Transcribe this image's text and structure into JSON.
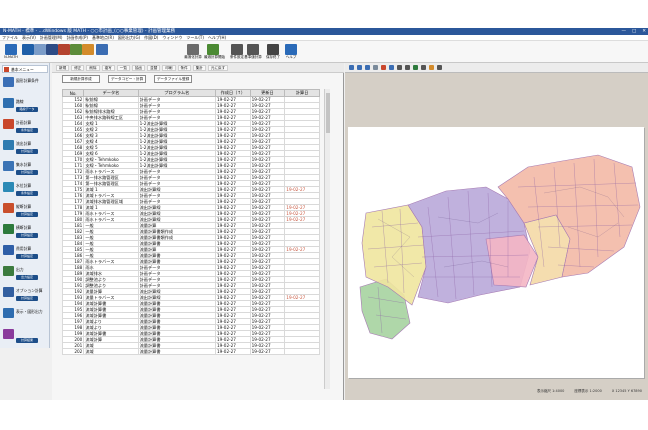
{
  "title_bar": {
    "title": "N-MATH - 標準 - ...dWindows 版 MATH - ○○市計画_(○○事業管理) - 計画管理業務",
    "sys_minimize": "—",
    "sys_maximize": "□",
    "sys_close": "✕"
  },
  "menu": [
    "ファイル",
    "表示(V)",
    "計画管理(M)",
    "計画作成(P)",
    "基準地点(R)",
    "図形出力(G)",
    "作図(D)",
    "ウィンドウ",
    "ツール(T)",
    "ヘルプ(H)"
  ],
  "toolbar": {
    "buttons": [
      {
        "label": "N-MATH",
        "icon": "app-icon",
        "color": "#2a6ab8"
      },
      {
        "label": "",
        "icon": "mountain-icon",
        "color": "#1f5fa8"
      },
      {
        "label": "",
        "icon": "table-icon",
        "color": "#7b9cc8"
      },
      {
        "label": "",
        "icon": "flag-icon",
        "color": "#2d4c86"
      },
      {
        "label": "",
        "icon": "truck-icon",
        "color": "#b4432f"
      },
      {
        "label": "",
        "icon": "blocks-icon",
        "color": "#5c8c3a"
      },
      {
        "label": "",
        "icon": "stamp-icon",
        "color": "#d38b2b"
      },
      {
        "label": "",
        "icon": "map-icon",
        "color": "#3b6db3"
      },
      {
        "label": "最適化計算",
        "icon": "grid-calc-icon",
        "color": "#6b6b6b"
      },
      {
        "label": "最適計算開始",
        "icon": "calc-start-icon",
        "color": "#4b8a33"
      },
      {
        "label": "条件設定",
        "icon": "condition-icon",
        "color": "#555555"
      },
      {
        "label": "基準値計算",
        "icon": "base-calc-icon",
        "color": "#555555"
      },
      {
        "label": "保存終了",
        "icon": "save-icon",
        "color": "#444444"
      },
      {
        "label": "ヘルプ",
        "icon": "help-icon",
        "color": "#2a6ab8"
      }
    ]
  },
  "sidebar": {
    "header": "基本メニュー",
    "items": [
      {
        "label": "図形計算条件",
        "chip": "",
        "icon": "shape-icon",
        "color": "#3b6fb6"
      },
      {
        "label": "路線",
        "chip": "路線データ",
        "icon": "route-icon",
        "color": "#2f6fb0"
      },
      {
        "label": "計画計算",
        "chip": "条件設定",
        "icon": "plan-icon",
        "color": "#c9472c"
      },
      {
        "label": "流出計算",
        "chip": "計算設定",
        "icon": "flow-icon",
        "color": "#2e7bb0"
      },
      {
        "label": "集水計算",
        "chip": "計算設定",
        "icon": "catchment-icon",
        "color": "#3b73b5"
      },
      {
        "label": "水位計算",
        "chip": "条件設定",
        "icon": "water-icon",
        "color": "#2c8ab6"
      },
      {
        "label": "縦断計算",
        "chip": "計算設定",
        "icon": "profile-icon",
        "color": "#c94f2c"
      },
      {
        "label": "横断計算",
        "chip": "計算設定",
        "icon": "cross-icon",
        "color": "#2d7a3c"
      },
      {
        "label": "費用計算",
        "chip": "計算設定",
        "icon": "cost-icon",
        "color": "#2f5fa8"
      },
      {
        "label": "出力",
        "chip": "出力設定",
        "icon": "output-icon",
        "color": "#3c7b3e"
      },
      {
        "label": "オプション計算",
        "chip": "計算設定",
        "icon": "option-icon",
        "color": "#335fa0"
      },
      {
        "label": "表示・図形出力",
        "chip": "",
        "icon": "display-icon",
        "color": "#2f6db0"
      },
      {
        "label": "",
        "chip": "計算結果",
        "icon": "result-icon",
        "color": "#8a3b9c"
      }
    ]
  },
  "grid_panel": {
    "tabs": [
      "新規",
      "修正",
      "削除",
      "複写",
      "一覧",
      "抽出",
      "並替",
      "印刷",
      "条件",
      "集計",
      "元に戻す"
    ],
    "buttons": [
      "新規計算作成",
      "データコピー・計算",
      "データファイル登録"
    ],
    "columns": [
      "No.",
      "データ名",
      "プログラム名",
      "作成日（↑）",
      "更新日",
      "計算日"
    ],
    "rows": [
      [
        "152",
        "駅前線",
        "計画データ",
        "19-02-27",
        "19-02-27",
        ""
      ],
      [
        "160",
        "駅前線",
        "計画データ",
        "19-02-27",
        "19-02-27",
        ""
      ],
      [
        "162",
        "駅前線排水路線",
        "計画データ",
        "19-02-27",
        "19-02-27",
        ""
      ],
      [
        "163",
        "中央排水路幹線工区",
        "計画データ",
        "19-02-27",
        "19-02-27",
        ""
      ],
      [
        "164",
        "支線 1",
        "1-2流出計算線",
        "19-02-27",
        "19-02-27",
        ""
      ],
      [
        "165",
        "支線 2",
        "1-2流出計算線",
        "19-02-27",
        "19-02-27",
        ""
      ],
      [
        "166",
        "支線 3",
        "1-2流出計算線",
        "19-02-27",
        "19-02-27",
        ""
      ],
      [
        "167",
        "支線 4",
        "1-2流出計算線",
        "19-02-27",
        "19-02-27",
        ""
      ],
      [
        "168",
        "支線 5",
        "1-2流出計算線",
        "19-02-27",
        "19-02-27",
        ""
      ],
      [
        "169",
        "支線 6",
        "1-2流出計算線",
        "19-02-27",
        "19-02-27",
        ""
      ],
      [
        "170",
        "支線・Tehmkoko",
        "1-2流出計算線",
        "19-02-27",
        "19-02-27",
        ""
      ],
      [
        "171",
        "支線・Tehmkoko",
        "1-2流出計算線",
        "19-02-27",
        "19-02-27",
        ""
      ],
      [
        "172",
        "雨水トラバース",
        "計画データ",
        "19-02-27",
        "19-02-27",
        ""
      ],
      [
        "173",
        "第一排水路管理区",
        "計画データ",
        "19-02-27",
        "19-02-27",
        ""
      ],
      [
        "174",
        "第一排水路管理区",
        "計画データ",
        "19-02-27",
        "19-02-27",
        ""
      ],
      [
        "175",
        "流域 1",
        "流出計算線",
        "19-02-27",
        "19-02-27",
        "19-02-27"
      ],
      [
        "176",
        "流域トラバース",
        "計画データ",
        "19-02-27",
        "19-02-27",
        ""
      ],
      [
        "177",
        "流域排水路管理区域",
        "計画データ",
        "19-02-27",
        "19-02-27",
        ""
      ],
      [
        "178",
        "流域 1",
        "流出計算線",
        "19-02-27",
        "19-02-27",
        "19-02-27"
      ],
      [
        "179",
        "雨水トラバース",
        "流出計算線",
        "19-02-27",
        "19-02-27",
        "19-02-27"
      ],
      [
        "180",
        "雨水トラバース",
        "流出計算線",
        "19-02-27",
        "19-02-27",
        "19-02-27"
      ],
      [
        "181",
        "一般",
        "流量計算",
        "19-02-27",
        "19-02-27",
        ""
      ],
      [
        "182",
        "一般",
        "流量計算書類作成",
        "19-02-27",
        "19-02-27",
        ""
      ],
      [
        "183",
        "一般",
        "流量計算書類作成",
        "19-02-27",
        "19-02-27",
        ""
      ],
      [
        "184",
        "一般",
        "流量計算書",
        "19-02-27",
        "19-02-27",
        ""
      ],
      [
        "185",
        "一般",
        "流量計算",
        "19-02-27",
        "19-02-27",
        "19-02-27"
      ],
      [
        "186",
        "一般",
        "流量計算書",
        "19-02-27",
        "19-02-27",
        ""
      ],
      [
        "187",
        "雨水トラバース",
        "流量計算書",
        "19-02-27",
        "19-02-27",
        ""
      ],
      [
        "188",
        "雨水",
        "計画データ",
        "19-02-27",
        "19-02-27",
        ""
      ],
      [
        "189",
        "流域排水",
        "計画データ",
        "19-02-27",
        "19-02-27",
        ""
      ],
      [
        "190",
        "調整池より",
        "計画データ",
        "19-02-27",
        "19-02-27",
        ""
      ],
      [
        "191",
        "調整池より",
        "計画データ",
        "19-02-27",
        "19-02-27",
        ""
      ],
      [
        "192",
        "流量計算",
        "流出計算線",
        "19-02-27",
        "19-02-27",
        ""
      ],
      [
        "193",
        "流量トラバース",
        "流出計算線",
        "19-02-27",
        "19-02-27",
        "19-02-27"
      ],
      [
        "194",
        "流域計算書",
        "流量計算書",
        "19-02-27",
        "19-02-27",
        ""
      ],
      [
        "195",
        "流域計算書",
        "流量計算書",
        "19-02-27",
        "19-02-27",
        ""
      ],
      [
        "196",
        "流域計算書",
        "流量計算書",
        "19-02-27",
        "19-02-27",
        ""
      ],
      [
        "197",
        "流域より",
        "流量計算書",
        "19-02-27",
        "19-02-27",
        ""
      ],
      [
        "198",
        "流域より",
        "流量計算書",
        "19-02-27",
        "19-02-27",
        ""
      ],
      [
        "199",
        "流域計算書",
        "流量計算書",
        "19-02-27",
        "19-02-27",
        ""
      ],
      [
        "200",
        "流域計算",
        "流量計算書",
        "19-02-27",
        "19-02-27",
        ""
      ],
      [
        "201",
        "流域",
        "流量計算書",
        "19-02-27",
        "19-02-27",
        ""
      ],
      [
        "202",
        "流域",
        "流量計算書",
        "19-02-27",
        "19-02-27",
        ""
      ]
    ]
  },
  "map_panel": {
    "tools": [
      "move-icon",
      "zoom-in-icon",
      "zoom-out-icon",
      "grid-icon",
      "layer-icon",
      "search-icon",
      "arrow-left-icon",
      "arrow-right-icon",
      "refresh-icon",
      "select-icon",
      "pen-icon",
      "ruler-icon"
    ],
    "regions": [
      {
        "name": "north-east",
        "color": "#f3b9a6"
      },
      {
        "name": "center",
        "color": "#b9a8d9"
      },
      {
        "name": "west",
        "color": "#efe59f"
      },
      {
        "name": "south-west",
        "color": "#a6d3a0"
      },
      {
        "name": "east-yellow",
        "color": "#f4d9a6"
      },
      {
        "name": "center-pink",
        "color": "#f4b6c4"
      }
    ]
  },
  "status": [
    "表示縮尺 1:4000",
    "座標表示 1:2000",
    "X 12345 Y 67890"
  ]
}
